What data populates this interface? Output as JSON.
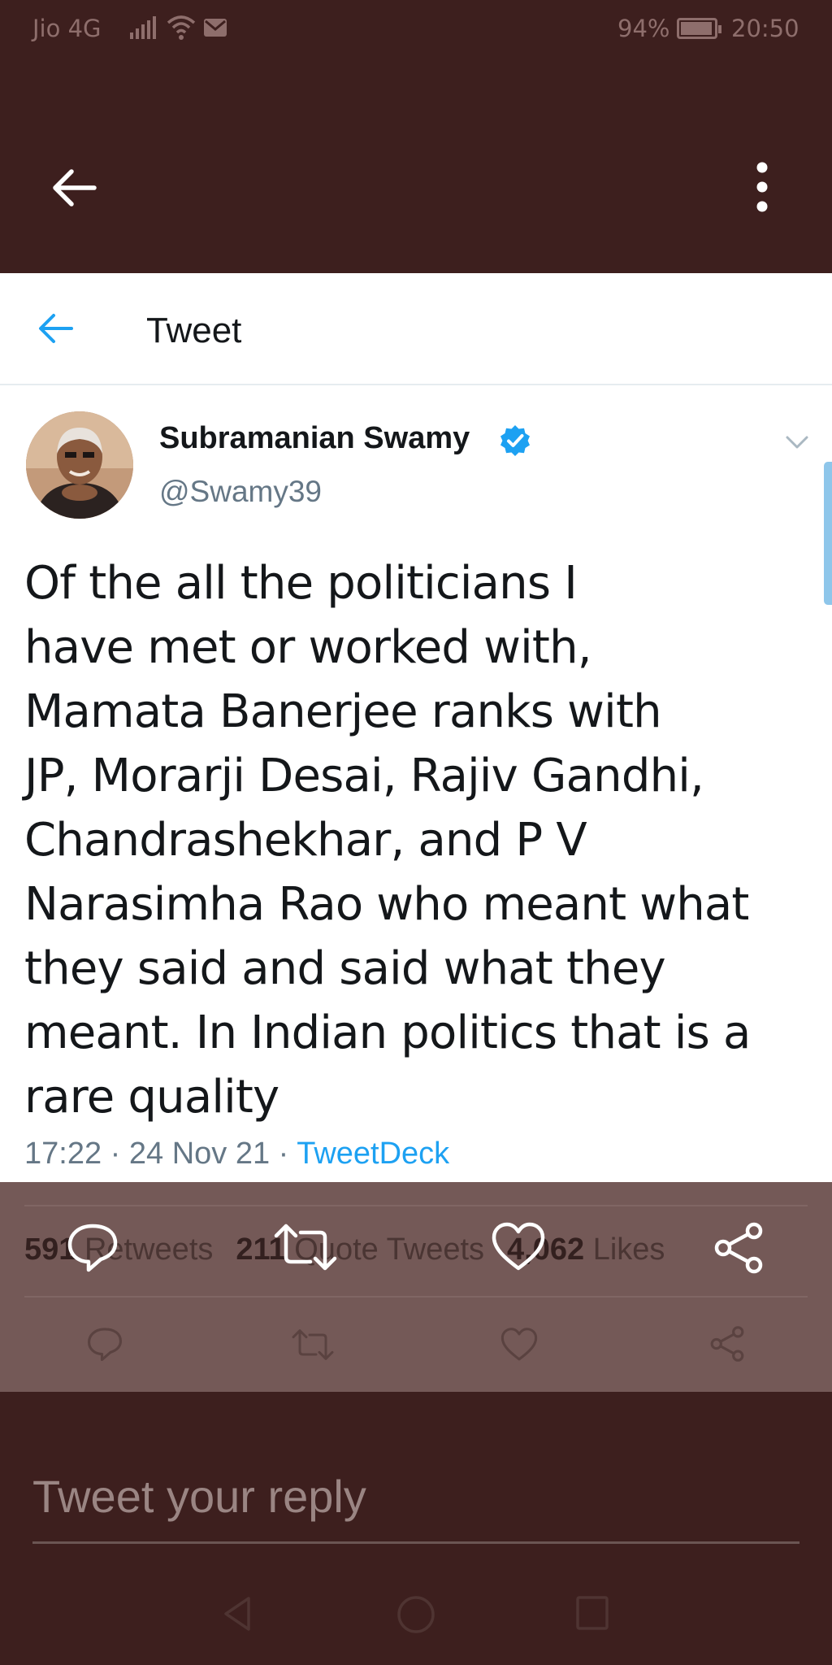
{
  "status_bar": {
    "carrier": "Jio 4G",
    "battery": "94%",
    "time": "20:50",
    "icons": [
      "signal-icon",
      "wifi-icon",
      "mail-icon",
      "battery-icon"
    ]
  },
  "app_bar": {
    "icons": [
      "back-arrow-icon",
      "more-vertical-icon"
    ]
  },
  "tweet_page": {
    "header_title": "Tweet",
    "author": {
      "name": "Subramanian Swamy",
      "handle": "@Swamy39",
      "verified": true
    },
    "text_lines": [
      "Of the all the politicians I",
      "have met or worked with,",
      "Mamata Banerjee ranks with",
      "JP, Morarji Desai, Rajiv Gandhi,",
      "Chandrashekhar, and P V",
      "Narasimha Rao who meant what",
      "they said and said what they",
      "meant. In Indian politics that is a",
      "rare quality"
    ],
    "meta": {
      "time": "17:22",
      "separator": " · ",
      "date": "24 Nov 21",
      "source": "TweetDeck"
    }
  },
  "stats": {
    "retweets_count": "591",
    "retweets_label": "Retweets",
    "quote_count": "211",
    "quote_label": "Quote Tweets",
    "likes_count": "4,062",
    "likes_label": "Likes"
  },
  "reply": {
    "placeholder": "Tweet your reply"
  },
  "colors": {
    "overlay_dark": "#3d1f1e",
    "overlay_panel": "#745957",
    "twitter_blue": "#1da1f2",
    "text_primary": "#14171a",
    "text_secondary": "#657786"
  }
}
